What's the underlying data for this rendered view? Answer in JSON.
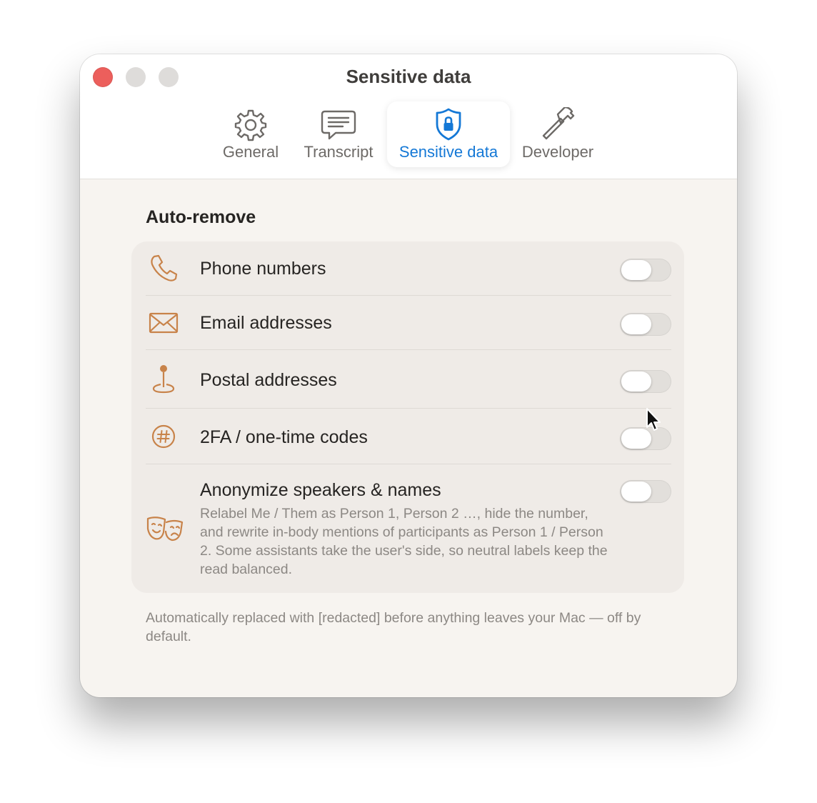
{
  "window": {
    "title": "Sensitive data"
  },
  "tabs": [
    {
      "label": "General",
      "icon": "gear-icon",
      "active": false
    },
    {
      "label": "Transcript",
      "icon": "speech-bubble-icon",
      "active": false
    },
    {
      "label": "Sensitive data",
      "icon": "lock-shield-icon",
      "active": true
    },
    {
      "label": "Developer",
      "icon": "hammer-icon",
      "active": false
    }
  ],
  "section": {
    "title": "Auto-remove"
  },
  "rows": [
    {
      "label": "Phone numbers",
      "icon": "phone-icon",
      "enabled": false
    },
    {
      "label": "Email addresses",
      "icon": "envelope-icon",
      "enabled": false
    },
    {
      "label": "Postal addresses",
      "icon": "map-pin-icon",
      "enabled": false
    },
    {
      "label": "2FA / one-time codes",
      "icon": "number-sign-icon",
      "enabled": false
    },
    {
      "label": "Anonymize speakers & names",
      "icon": "theater-masks-icon",
      "enabled": false,
      "description": "Relabel Me / Them as Person 1, Person 2 …, hide the number, and rewrite in-body mentions of participants as Person 1 / Person 2. Some assistants take the user's side, so neutral labels keep the read balanced."
    }
  ],
  "footer": {
    "text": "Automatically replaced with [redacted] before anything leaves your Mac — off by default."
  },
  "colors": {
    "accent": "#1478d6",
    "icon_orange": "#c8834a",
    "close": "#ec5f5c"
  }
}
